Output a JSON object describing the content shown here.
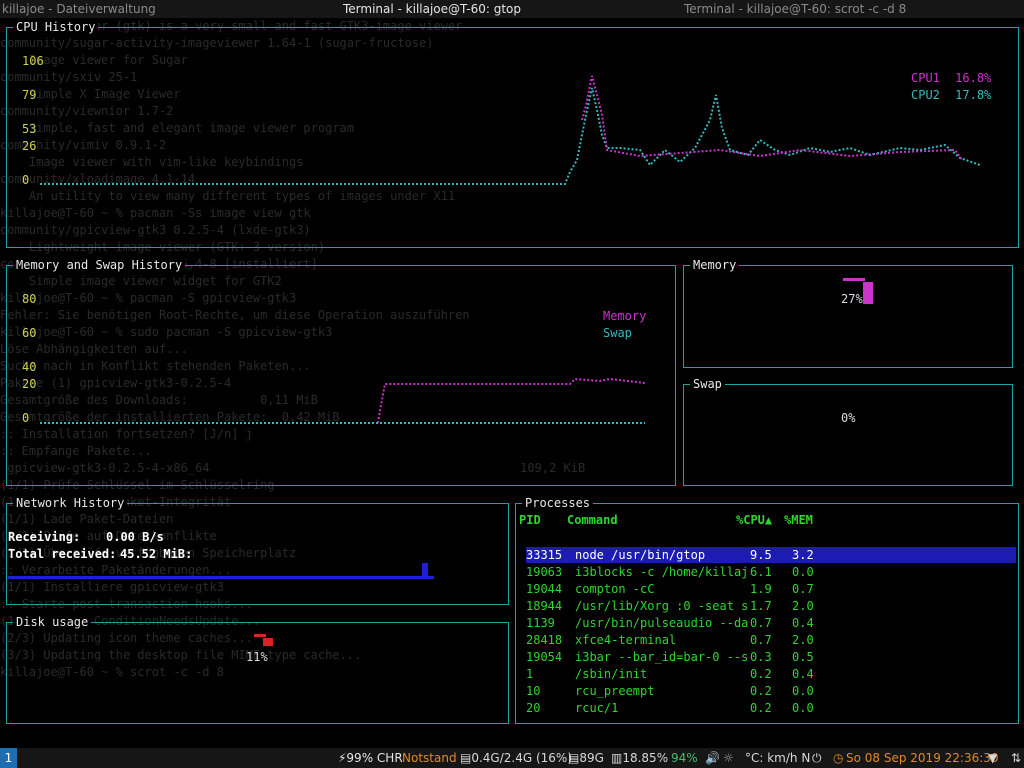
{
  "window": {
    "title_left": "killajoe - Dateiverwaltung",
    "title_center": "Terminal - killajoe@T-60: gtop",
    "title_right": "Terminal - killajoe@T-60: scrot -c -d 8"
  },
  "panels": {
    "cpu": {
      "title": "CPU History",
      "ticks": [
        "106",
        "79",
        "53",
        "26",
        "0"
      ],
      "legend": [
        {
          "label": "CPU1",
          "value": "16.8%",
          "color": "#cc33cc"
        },
        {
          "label": "CPU2",
          "value": "17.8%",
          "color": "#33bbbb"
        }
      ]
    },
    "memswap": {
      "title": "Memory and Swap History",
      "ticks": [
        "80",
        "60",
        "40",
        "20",
        "0"
      ],
      "legend": [
        {
          "label": "Memory",
          "color": "#cc33cc"
        },
        {
          "label": "Swap",
          "color": "#33bbbb"
        }
      ]
    },
    "memory": {
      "title": "Memory",
      "percent": "27%",
      "fraction": 0.27
    },
    "swap": {
      "title": "Swap",
      "percent": "0%",
      "fraction": 0.0
    },
    "network": {
      "title": "Network History",
      "receiving_label": "Receiving:",
      "receiving_value": "0.00 B/s",
      "total_label": "Total received:",
      "total_value": "45.52 MiB:"
    },
    "disk": {
      "title": "Disk usage",
      "percent": "11%",
      "fraction": 0.11
    },
    "processes": {
      "title": "Processes",
      "columns": [
        "PID",
        "Command",
        "%CPU▲",
        "%MEM"
      ],
      "rows": [
        {
          "pid": "33315",
          "command": "node /usr/bin/gtop",
          "cpu": "9.5",
          "mem": "3.2",
          "selected": true
        },
        {
          "pid": "19063",
          "command": "i3blocks -c /home/killaj",
          "cpu": "6.1",
          "mem": "0.0"
        },
        {
          "pid": "19044",
          "command": "compton -cC",
          "cpu": "1.9",
          "mem": "0.7"
        },
        {
          "pid": "18944",
          "command": "/usr/lib/Xorg :0 -seat s",
          "cpu": "1.7",
          "mem": "2.0"
        },
        {
          "pid": "1139",
          "command": "/usr/bin/pulseaudio --da",
          "cpu": "0.7",
          "mem": "0.4"
        },
        {
          "pid": "28418",
          "command": "xfce4-terminal",
          "cpu": "0.7",
          "mem": "2.0"
        },
        {
          "pid": "19054",
          "command": "i3bar --bar_id=bar-0 --s",
          "cpu": "0.3",
          "mem": "0.5"
        },
        {
          "pid": "1",
          "command": "/sbin/init",
          "cpu": "0.2",
          "mem": "0.4"
        },
        {
          "pid": "10",
          "command": "rcu_preempt",
          "cpu": "0.2",
          "mem": "0.0"
        },
        {
          "pid": "20",
          "command": "rcuc/1",
          "cpu": "0.2",
          "mem": "0.0"
        }
      ]
    }
  },
  "statusbar": {
    "workspace": "1",
    "battery": "⚡99% CHR",
    "notstand": "Notstand",
    "mem": "▤0.4G/2.4G (16%)",
    "disk": "▤89G",
    "cpu": "▥18.85%",
    "volume": "94%",
    "weather": "°C: km/h N",
    "datetime": "So 08 Sep 2019 22:36:30"
  },
  "ghost_lines": [
    "  Simple viewer (gtk) is a very small and fast GTK3-image viewer",
    "community/sugar-activity-imageviewer 1.64-1 (sugar-fructose)",
    "    Image viewer for Sugar",
    "community/sxiv 25-1",
    "    Simple X Image Viewer",
    "community/viewnior 1.7-2",
    "    Simple, fast and elegant image viewer program",
    "community/vimiv 0.9.1-2",
    "    Image viewer with vim-like keybindings",
    "community/xloadimage 4.1-14",
    "    An utility to view many different types of images under X11",
    "killajoe@T-60 ~ % pacman -Ss image view gtk",
    "community/gpicview-gtk3 0.2.5-4 (lxde-gtk3)",
    "    Lightweight image viewer (GTK+ 3 version)",
    "community/gtkimageview 1.6.4-8 [installiert]",
    "    Simple image viewer widget for GTK2",
    "killajoe@T-60 ~ % pacman -S gpicview-gtk3",
    "Fehler: Sie benötigen Root-Rechte, um diese Operation auszuführen",
    "killajoe@T-60 ~ % sudo pacman -S gpicview-gtk3",
    "Löse Abhängigkeiten auf...",
    "Suche nach in Konflikt stehenden Paketen...",
    "",
    "Pakete (1) gpicview-gtk3-0.2.5-4",
    "",
    "Gesamtgröße des Downloads:          0,11 MiB",
    "Gesamtgröße der installierten Pakete:  0,42 MiB",
    "",
    ":: Installation fortsetzen? [J/n] j",
    ":: Empfange Pakete...",
    " gpicview-gtk3-0.2.5-4-x86_64                                           109,2 KiB",
    "(1/1) Prüfe Schlüssel im Schlüsselring",
    "(1/1) Überprüfe Paket-Integrität",
    "(1/1) Lade Paket-Dateien",
    "(1/1) Prüfe auf Dateikonflikte",
    "(1/1) Überprüfe verfügbaren Speicherplatz",
    ":: Verarbeite Paketänderungen...",
    "(1/1) Installiere gpicview-gtk3",
    ":: Starte post-transaction hooks...",
    "(1/3) Arming ConditionNeedsUpdate...",
    "(2/3) Updating icon theme caches...",
    "(3/3) Updating the desktop file MIME type cache...",
    "killajoe@T-60 ~ % scrot -c -d 8",
    "     "
  ]
}
